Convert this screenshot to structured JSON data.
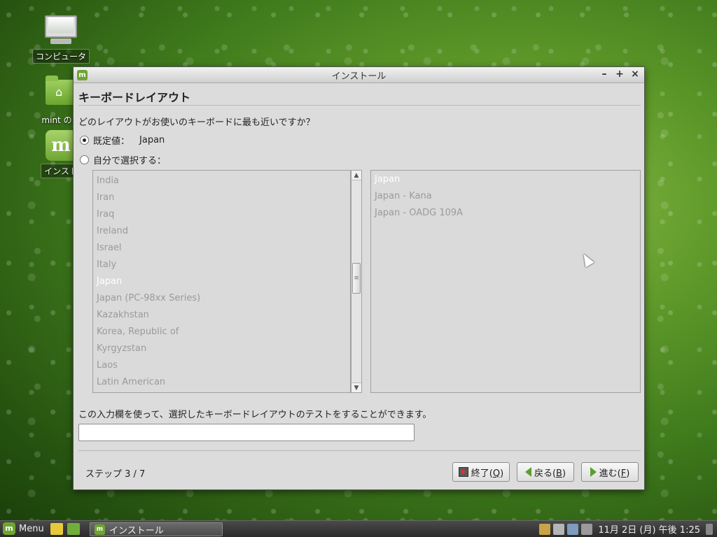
{
  "desktop": {
    "icons": [
      {
        "label": "コンピュータ",
        "icon": "computer-icon"
      },
      {
        "label": "mint のホ",
        "icon": "home-folder-icon"
      },
      {
        "label": "インスト",
        "icon": "mint-install-icon"
      }
    ]
  },
  "window": {
    "title": "インストール",
    "controls": {
      "minimize": "–",
      "maximize": "+",
      "close": "×"
    },
    "heading": "キーボードレイアウト",
    "question": "どのレイアウトがお使いのキーボードに最も近いですか？",
    "default_option": {
      "label": "既定値：",
      "value": "Japan",
      "selected": true
    },
    "custom_option": {
      "label": "自分で選択する：",
      "selected": false
    },
    "layouts": [
      {
        "label": "India"
      },
      {
        "label": "Iran"
      },
      {
        "label": "Iraq"
      },
      {
        "label": "Ireland"
      },
      {
        "label": "Israel"
      },
      {
        "label": "Italy"
      },
      {
        "label": "Japan",
        "selected": true
      },
      {
        "label": "Japan (PC-98xx Series)"
      },
      {
        "label": "Kazakhstan"
      },
      {
        "label": "Korea, Republic of"
      },
      {
        "label": "Kyrgyzstan"
      },
      {
        "label": "Laos"
      },
      {
        "label": "Latin American"
      }
    ],
    "variants": [
      {
        "label": "Japan",
        "selected": true
      },
      {
        "label": "Japan - Kana"
      },
      {
        "label": "Japan - OADG 109A"
      }
    ],
    "test_label": "この入力欄を使って、選択したキーボードレイアウトのテストをすることができます。",
    "test_value": "",
    "step": "ステップ 3 / 7",
    "buttons": {
      "quit": {
        "text": "終了(",
        "key": "Q",
        "end": ")"
      },
      "back": {
        "text": "戻る(",
        "key": "B",
        "end": ")"
      },
      "forward": {
        "text": "進む(",
        "key": "F",
        "end": ")"
      }
    }
  },
  "taskbar": {
    "menu_label": "Menu",
    "task_label": "インストール",
    "clock": "11月 2日 (月) 午後 1:25"
  },
  "colors": {
    "mint_green": "#6ea531",
    "window_bg": "#dcdcdc",
    "list_text": "#9a9a9a",
    "list_selected_text": "#ffffff"
  }
}
